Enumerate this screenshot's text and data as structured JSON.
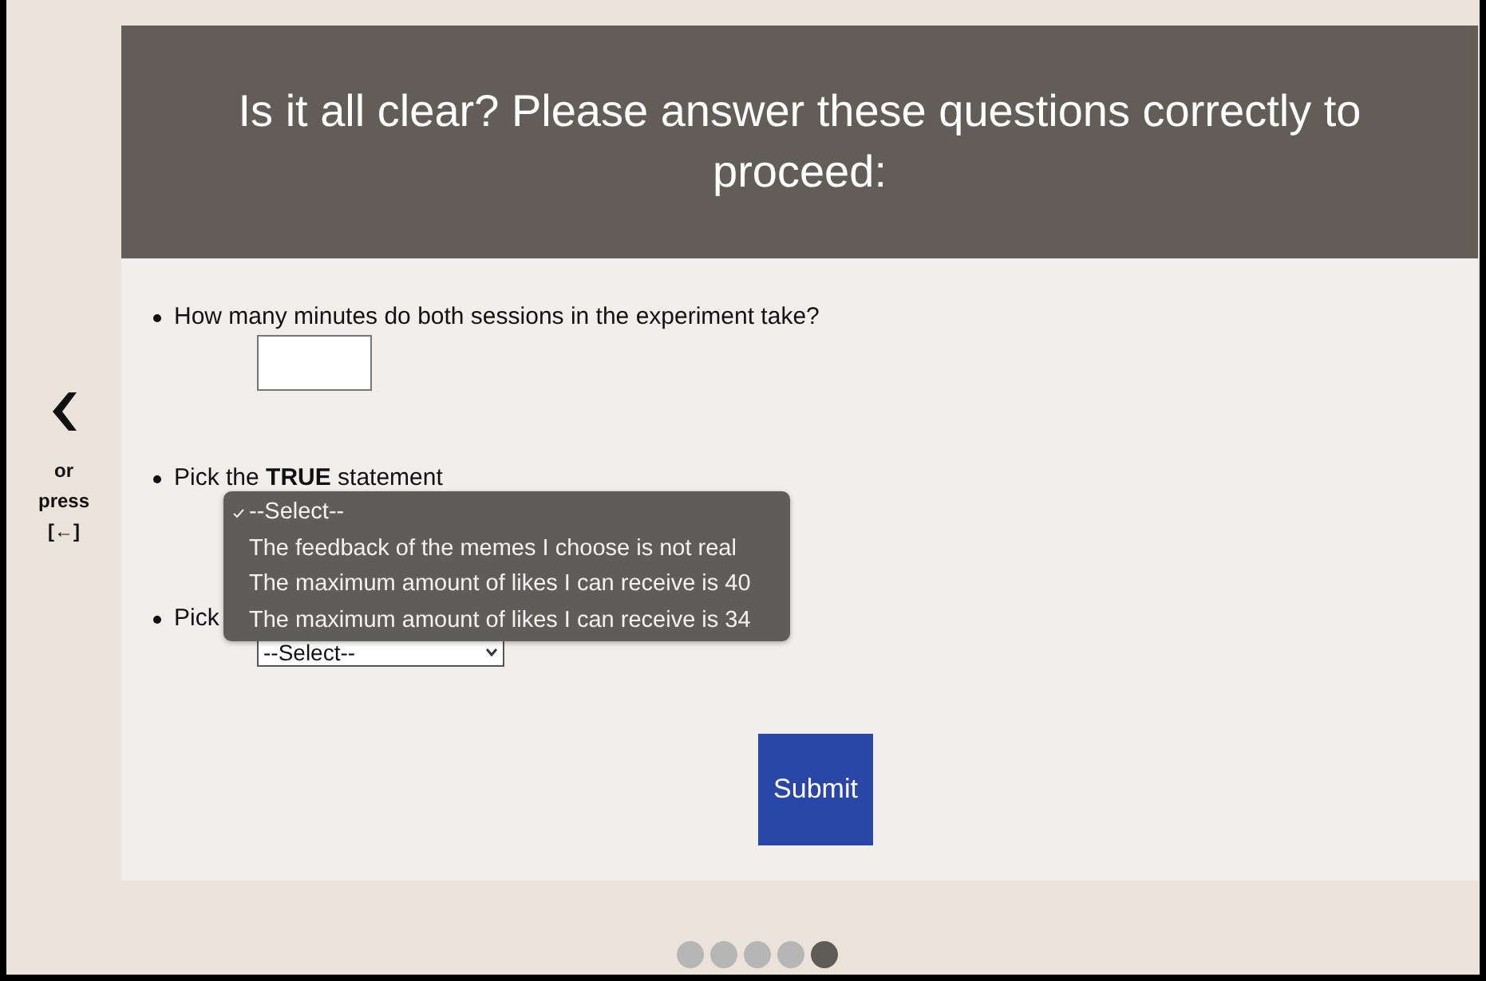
{
  "header": {
    "title": "Is it all clear? Please answer these questions correctly to proceed:"
  },
  "back_nav": {
    "hint_lines": [
      "or",
      "press",
      "[←]"
    ]
  },
  "questions": [
    {
      "kind": "input",
      "text": "How many minutes do both sessions in the experiment take?"
    },
    {
      "kind": "open_select",
      "text": "Pick the **TRUE** statement",
      "options": [
        {
          "label": "--Select--",
          "selected": true
        },
        {
          "label": "The feedback of the memes I choose is not real",
          "selected": false
        },
        {
          "label": "The maximum amount of likes I can receive is 40",
          "selected": false
        },
        {
          "label": "The maximum amount of likes I can receive is 34",
          "selected": false
        }
      ]
    },
    {
      "kind": "select",
      "text": "Pick",
      "value": "--Select--"
    }
  ],
  "submit": {
    "label": "Submit"
  },
  "pager": [
    {
      "selected": false
    },
    {
      "selected": false
    },
    {
      "selected": false
    },
    {
      "selected": false
    },
    {
      "selected": true
    }
  ]
}
